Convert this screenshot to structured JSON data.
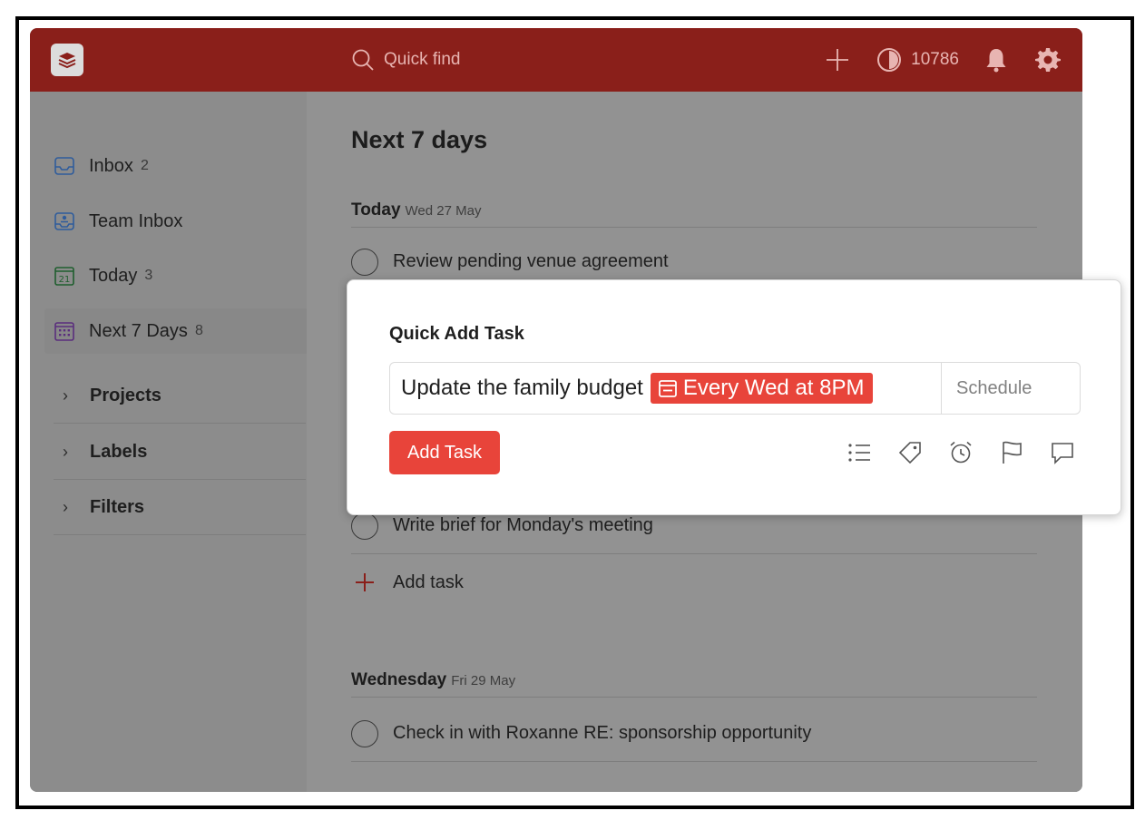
{
  "topbar": {
    "search_placeholder": "Quick find",
    "karma_value": "10786"
  },
  "sidebar": {
    "items": [
      {
        "label": "Inbox",
        "count": "2",
        "icon": "inbox-icon"
      },
      {
        "label": "Team Inbox",
        "count": "",
        "icon": "team-inbox-icon"
      },
      {
        "label": "Today",
        "count": "3",
        "icon": "calendar-today-icon"
      },
      {
        "label": "Next 7 Days",
        "count": "8",
        "icon": "calendar-week-icon"
      }
    ],
    "sections": [
      "Projects",
      "Labels",
      "Filters"
    ]
  },
  "main": {
    "title": "Next 7 days",
    "days": [
      {
        "name": "Today",
        "date": "Wed 27 May",
        "tasks": [
          "Review pending venue agreement",
          "Write brief for Monday's meeting"
        ],
        "add_label": "Add task"
      },
      {
        "name": "Wednesday",
        "date": "Fri 29 May",
        "tasks": [
          "Check in with Roxanne RE: sponsorship opportunity"
        ]
      }
    ]
  },
  "modal": {
    "title": "Quick Add Task",
    "input_text": "Update the family budget",
    "date_chip": "Every Wed at 8PM",
    "schedule_label": "Schedule",
    "add_button": "Add Task",
    "tools": [
      "subtask-list-icon",
      "label-tag-icon",
      "alarm-clock-icon",
      "priority-flag-icon",
      "comment-icon"
    ]
  },
  "colors": {
    "brand_red": "#e8443a",
    "topbar_dimmed": "#8a1f1a",
    "overlay_gray": "#929292"
  }
}
